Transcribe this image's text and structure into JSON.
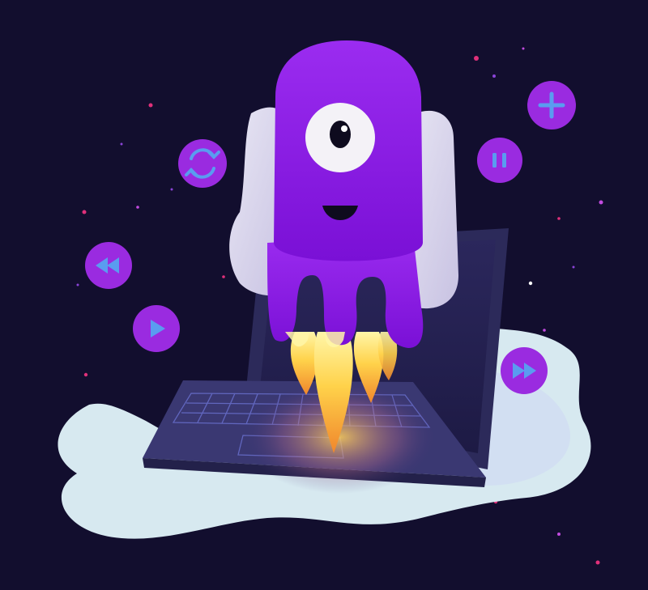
{
  "scene": {
    "subject": "purple-one-eyed-octopus-rocket",
    "background_color": "#120e2e",
    "creature_color": "#8a1be0",
    "button_color": "#9a2be0",
    "button_icon_color": "#5a9cf0",
    "laptop_color": "#2c2a5a",
    "flame_color": "#f7c33a",
    "puddle_color": "#d7e9f0"
  },
  "media_buttons": [
    {
      "icon": "refresh-icon"
    },
    {
      "icon": "pause-icon"
    },
    {
      "icon": "plus-icon"
    },
    {
      "icon": "rewind-icon"
    },
    {
      "icon": "play-icon"
    },
    {
      "icon": "fast-forward-icon"
    }
  ]
}
